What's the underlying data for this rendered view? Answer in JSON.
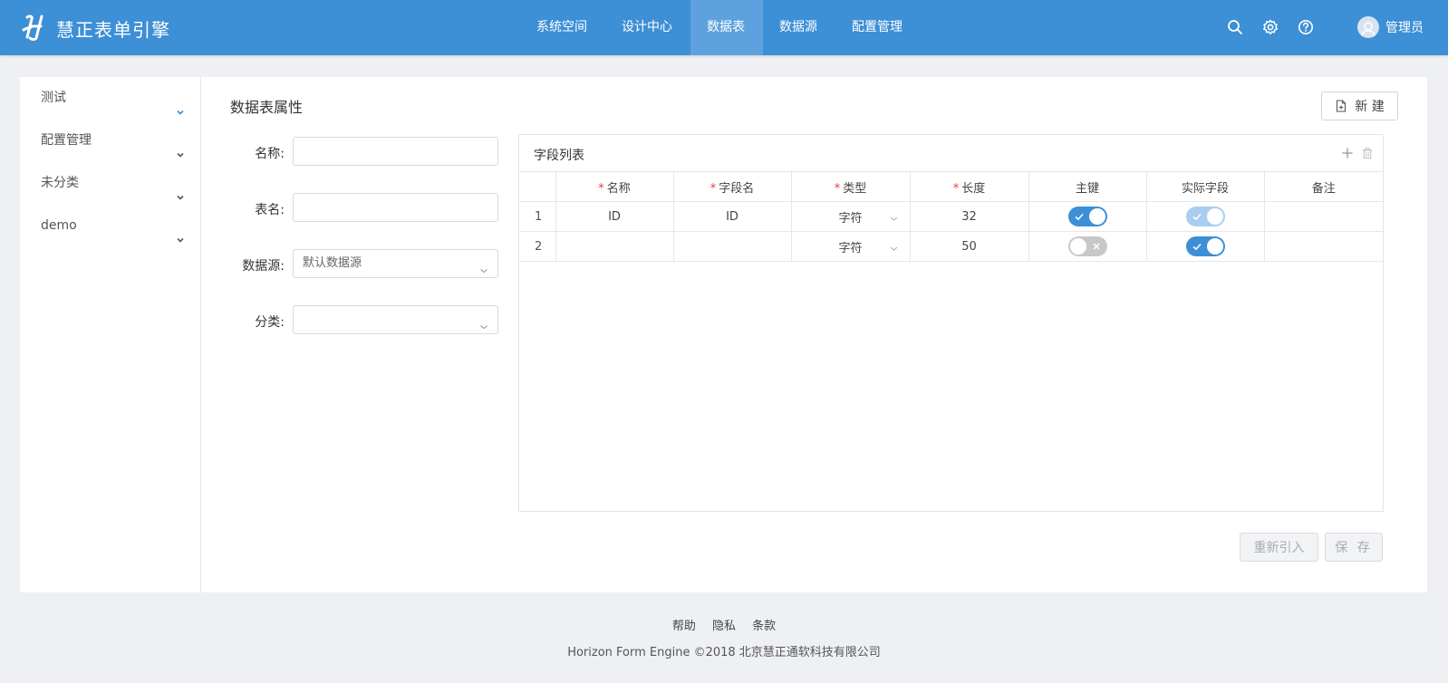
{
  "app": {
    "title": "慧正表单引擎",
    "logo_icon": "h-logo-icon",
    "accent": "#3d8fd6"
  },
  "nav": [
    {
      "label": "系统空间"
    },
    {
      "label": "设计中心"
    },
    {
      "label": "数据表",
      "active": true
    },
    {
      "label": "数据源"
    },
    {
      "label": "配置管理"
    }
  ],
  "header_icons": [
    "search-icon",
    "gear-icon",
    "help-icon"
  ],
  "user": {
    "name": "管理员"
  },
  "sidebar": {
    "items": [
      {
        "label": "测试",
        "expanded": true
      },
      {
        "label": "配置管理"
      },
      {
        "label": "未分类"
      },
      {
        "label": "demo"
      }
    ]
  },
  "section": {
    "title": "数据表属性",
    "new_button": "新 建"
  },
  "form": {
    "name_label": "名称:",
    "name_value": "",
    "table_label": "表名:",
    "table_value": "",
    "datasource_label": "数据源:",
    "datasource_value": "默认数据源",
    "category_label": "分类:",
    "category_value": ""
  },
  "fields": {
    "title": "字段列表",
    "columns": [
      "名称",
      "字段名",
      "类型",
      "长度",
      "主键",
      "实际字段",
      "备注"
    ],
    "required_mark": "*",
    "rows": [
      {
        "index": "1",
        "name": "ID",
        "field": "ID",
        "type": "字符",
        "length": "32",
        "primary_key": true,
        "actual": true,
        "actual_disabled": true,
        "note": ""
      },
      {
        "index": "2",
        "name": "",
        "field": "",
        "type": "字符",
        "length": "50",
        "primary_key": false,
        "actual": true,
        "actual_disabled": false,
        "note": ""
      }
    ]
  },
  "actions": {
    "reimport": "重新引入",
    "save": "保 存"
  },
  "footer": {
    "links": [
      "帮助",
      "隐私",
      "条款"
    ],
    "copyright": "Horizon Form Engine ©2018 北京慧正通软科技有限公司"
  }
}
